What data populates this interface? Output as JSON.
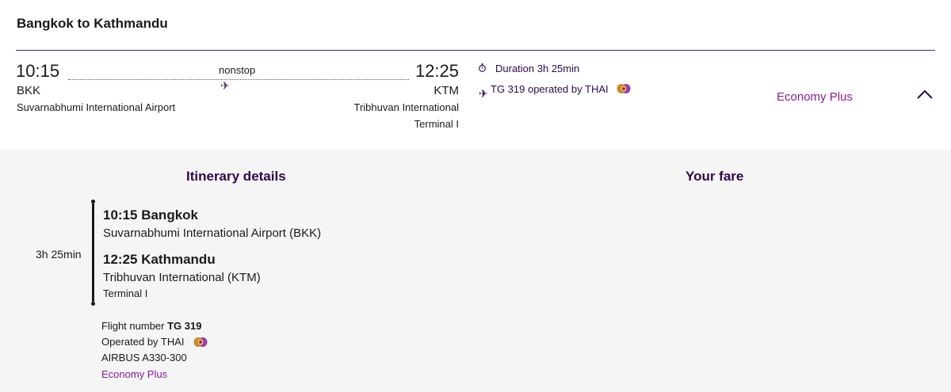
{
  "header": {
    "route_title": "Bangkok to Kathmandu"
  },
  "summary": {
    "departure": {
      "time": "10:15",
      "code": "BKK",
      "airport": "Suvarnabhumi International Airport"
    },
    "arrival": {
      "time": "12:25",
      "code": "KTM",
      "airport": "Tribhuvan International",
      "terminal": "Terminal I"
    },
    "stops_label": "nonstop",
    "duration_label": "Duration 3h 25min",
    "operated_label": "TG 319 operated by THAI",
    "cabin": "Economy Plus",
    "icons": {
      "duration": "stopwatch-icon",
      "plane": "plane-icon",
      "airline_logo": "thai-airways-logo",
      "collapse": "chevron-up-icon"
    }
  },
  "details": {
    "itinerary_title": "Itinerary details",
    "fare_title": "Your fare",
    "segment_duration": "3h 25min",
    "departure_heading": "10:15 Bangkok",
    "departure_airport": "Suvarnabhumi International Airport (BKK)",
    "arrival_heading": "12:25 Kathmandu",
    "arrival_airport": "Tribhuvan International (KTM)",
    "arrival_terminal": "Terminal I",
    "flight_number_label": "Flight number",
    "flight_number": "TG 319",
    "operated_by": "Operated by THAI",
    "aircraft": "AIRBUS A330-300",
    "cabin": "Economy Plus"
  },
  "colors": {
    "accent_purple": "#8a1a9a",
    "dark_purple": "#2b0a4a",
    "divider": "#4b2a6b",
    "panel_bg": "#f5f5f5"
  }
}
